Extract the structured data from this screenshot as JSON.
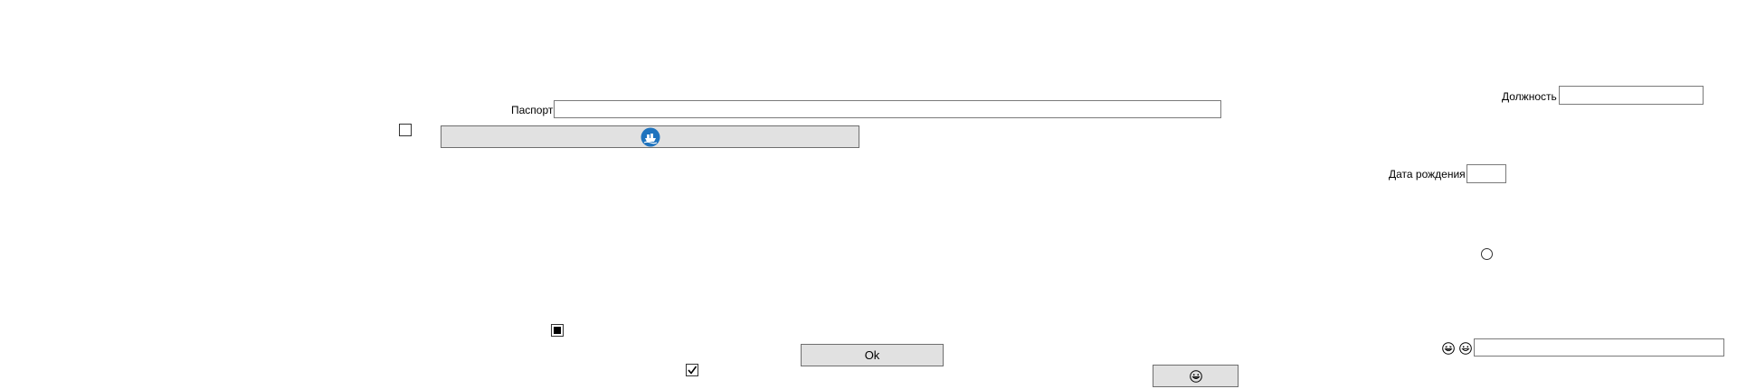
{
  "form": {
    "passport_label": "Паспорт",
    "passport_value": "",
    "position_label": "Должность",
    "position_value": "",
    "birthdate_label": "Дата рождения",
    "birthdate_value": "",
    "bottom_right_value": "",
    "ok_label": "Ok"
  },
  "icons": {
    "image_button_icon": "boat-badge-icon",
    "emoji_button_icon": "grinning-face-icon",
    "emoji_left_icon": "laughing-face-icon",
    "emoji_right_icon": "smiling-face-icon"
  },
  "states": {
    "top_checkbox_checked": false,
    "indeterminate_checkbox": "indeterminate",
    "bottom_checkbox_checked": true,
    "radio_selected": false
  },
  "colors": {
    "button_bg": "#e1e1e1",
    "border": "#7a7a7a",
    "icon_blue": "#1e73be"
  }
}
